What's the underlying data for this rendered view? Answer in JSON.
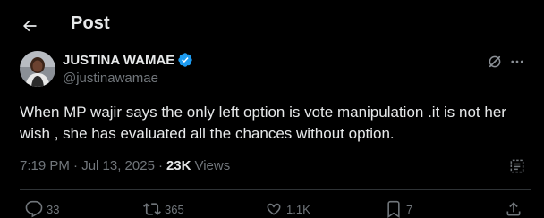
{
  "header": {
    "title": "Post"
  },
  "author": {
    "name": "JUSTINA WAMAE",
    "handle": "@justinawamae"
  },
  "tweet": {
    "text": "When MP wajir says the only left option is vote manipulation .it is not her wish , she has evaluated all the chances without option."
  },
  "meta": {
    "timestamp": "7:19 PM · Jul 13, 2025",
    "separator": "·",
    "views_count": "23K",
    "views_label": "Views"
  },
  "actions": {
    "replies": "33",
    "reposts": "365",
    "likes": "1.1K",
    "bookmarks": "7"
  },
  "colors": {
    "background": "#000000",
    "text_primary": "#e7e9ea",
    "text_secondary": "#71767b",
    "verified": "#1d9bf0",
    "divider": "#2f3336"
  },
  "icons": {
    "back": "arrow-left-icon",
    "verified": "verified-badge-icon",
    "grok": "grok-icon",
    "more": "more-horizontal-icon",
    "analytics": "analytics-icon",
    "reply": "reply-icon",
    "repost": "repost-icon",
    "like": "heart-icon",
    "bookmark": "bookmark-icon",
    "share": "share-icon"
  }
}
